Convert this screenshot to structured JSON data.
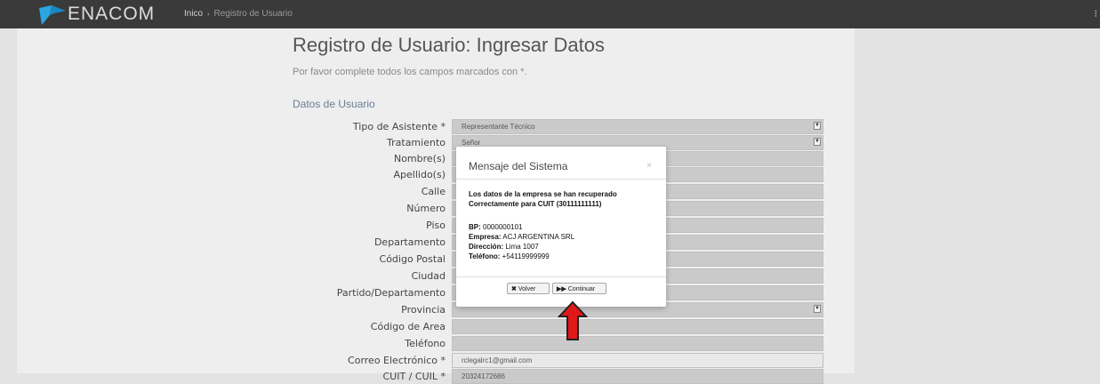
{
  "app": {
    "logo_text": "ENACOM"
  },
  "breadcrumb": {
    "home": "Inico",
    "separator": "›",
    "current": "Registro de Usuario"
  },
  "page": {
    "title": "Registro de Usuario: Ingresar Datos",
    "subtitle": "Por favor complete todos los campos marcados con *.",
    "section": "Datos de Usuario"
  },
  "form": {
    "fields": [
      {
        "label": "Tipo de Asistente *",
        "value": "Representante Técnico",
        "dropdown": true
      },
      {
        "label": "Tratamiento",
        "value": "Señor",
        "dropdown": true
      },
      {
        "label": "Nombre(s)",
        "value": ""
      },
      {
        "label": "Apellido(s)",
        "value": ""
      },
      {
        "label": "Calle",
        "value": ""
      },
      {
        "label": "Número",
        "value": ""
      },
      {
        "label": "Piso",
        "value": ""
      },
      {
        "label": "Departamento",
        "value": ""
      },
      {
        "label": "Código Postal",
        "value": ""
      },
      {
        "label": "Ciudad",
        "value": ""
      },
      {
        "label": "Partido/Departamento",
        "value": ""
      },
      {
        "label": "Provincia",
        "value": "",
        "dropdown": true
      },
      {
        "label": "Código de Area",
        "value": ""
      },
      {
        "label": "Teléfono",
        "value": ""
      },
      {
        "label": "Correo Electrónico *",
        "value": "rclegalrc1@gmail.com"
      },
      {
        "label": "CUIT / CUIL *",
        "value": "20324172686"
      }
    ]
  },
  "modal": {
    "title": "Mensaje del Sistema",
    "close": "×",
    "message": "Los datos de la empresa se han recuperado Correctamente para CUIT (30111111111)",
    "bp_label": "BP:",
    "bp_value": "0000000101",
    "empresa_label": "Empresa:",
    "empresa_value": "ACJ ARGENTINA SRL",
    "direccion_label": "Dirección:",
    "direccion_value": "Lima 1007",
    "telefono_label": "Teléfono:",
    "telefono_value": "+54119999999",
    "volver_label": "Volver",
    "continuar_label": "Continuar"
  },
  "colors": {
    "topbar": "#3a3a3a",
    "logo": "#2aa7e1",
    "arrow": "#e01818"
  }
}
